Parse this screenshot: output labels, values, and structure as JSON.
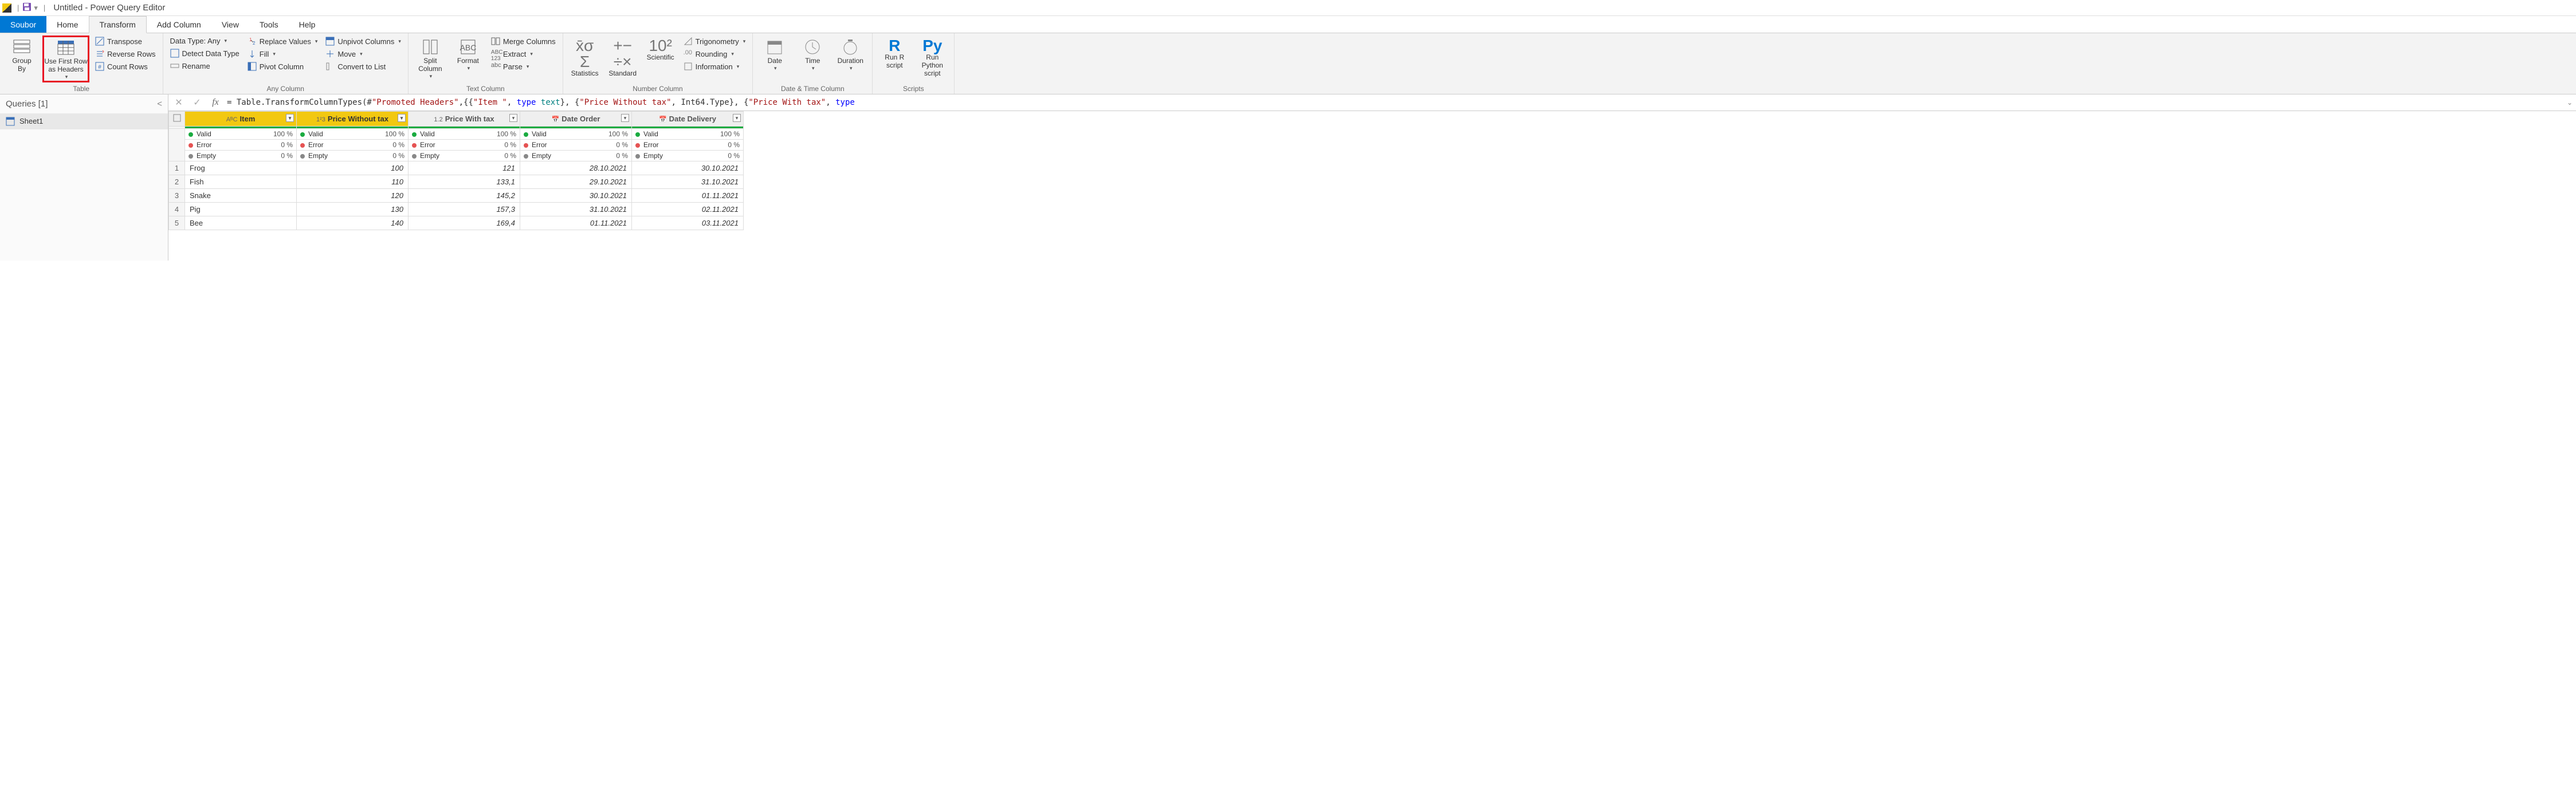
{
  "title": "Untitled - Power Query Editor",
  "menu": {
    "file": "Soubor",
    "tabs": [
      "Home",
      "Transform",
      "Add Column",
      "View",
      "Tools",
      "Help"
    ],
    "active": "Transform"
  },
  "ribbon": {
    "groups": {
      "table": {
        "label": "Table",
        "groupBy": "Group\nBy",
        "useFirstRow": "Use First Row\nas Headers",
        "transpose": "Transpose",
        "reverseRows": "Reverse Rows",
        "countRows": "Count Rows"
      },
      "anyColumn": {
        "label": "Any Column",
        "dataType": "Data Type: Any",
        "detect": "Detect Data Type",
        "rename": "Rename",
        "replace": "Replace Values",
        "fill": "Fill",
        "pivot": "Pivot Column",
        "unpivot": "Unpivot Columns",
        "move": "Move",
        "convert": "Convert to List"
      },
      "textColumn": {
        "label": "Text Column",
        "split": "Split\nColumn",
        "format": "Format",
        "merge": "Merge Columns",
        "extract": "Extract",
        "parse": "Parse"
      },
      "numberColumn": {
        "label": "Number Column",
        "statistics": "Statistics",
        "standard": "Standard",
        "scientific": "Scientific",
        "trig": "Trigonometry",
        "rounding": "Rounding",
        "info": "Information"
      },
      "dateTime": {
        "label": "Date & Time Column",
        "date": "Date",
        "time": "Time",
        "duration": "Duration"
      },
      "scripts": {
        "label": "Scripts",
        "r": "Run R\nscript",
        "py": "Run Python\nscript"
      }
    }
  },
  "queries": {
    "header": "Queries [1]",
    "items": [
      "Sheet1"
    ]
  },
  "formula": {
    "prefix": "= Table.TransformColumnTypes(#",
    "s1": "\"Promoted Headers\"",
    "mid1": ",{{",
    "s2": "\"Item \"",
    "mid2": ", ",
    "kw_type1": "type",
    "sp": " ",
    "typ_text": "text",
    "mid3": "}, {",
    "s3": "\"Price Without tax\"",
    "mid4": ", Int64.Type}, {",
    "s4": "\"Price With tax\"",
    "mid5": ", ",
    "kw_type2": "type"
  },
  "columns": [
    {
      "type": "AᴮC",
      "name": "Item",
      "highlight": true
    },
    {
      "type": "1²3",
      "name": "Price Without tax",
      "highlight": true
    },
    {
      "type": "1.2",
      "name": "Price With tax",
      "highlight": false
    },
    {
      "type": "📅",
      "name": "Date Order",
      "highlight": false
    },
    {
      "type": "📅",
      "name": "Date Delivery",
      "highlight": false
    }
  ],
  "quality": {
    "valid": "Valid",
    "validPct": "100 %",
    "error": "Error",
    "errorPct": "0 %",
    "empty": "Empty",
    "emptyPct": "0 %"
  },
  "rows": [
    {
      "n": "1",
      "item": "Frog",
      "pwt": "100",
      "pwtax": "121",
      "dorder": "28.10.2021",
      "ddeliv": "30.10.2021"
    },
    {
      "n": "2",
      "item": "Fish",
      "pwt": "110",
      "pwtax": "133,1",
      "dorder": "29.10.2021",
      "ddeliv": "31.10.2021"
    },
    {
      "n": "3",
      "item": "Snake",
      "pwt": "120",
      "pwtax": "145,2",
      "dorder": "30.10.2021",
      "ddeliv": "01.11.2021"
    },
    {
      "n": "4",
      "item": "Pig",
      "pwt": "130",
      "pwtax": "157,3",
      "dorder": "31.10.2021",
      "ddeliv": "02.11.2021"
    },
    {
      "n": "5",
      "item": "Bee",
      "pwt": "140",
      "pwtax": "169,4",
      "dorder": "01.11.2021",
      "ddeliv": "03.11.2021"
    }
  ]
}
